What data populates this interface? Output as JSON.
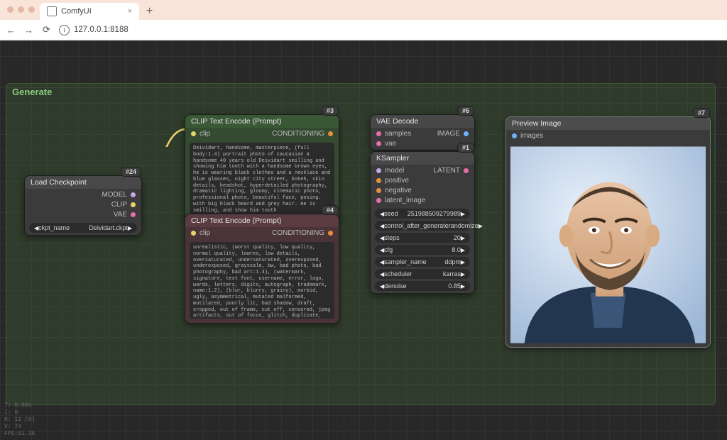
{
  "browser": {
    "tab_title": "ComfyUI",
    "new_tab": "+",
    "back": "←",
    "forward": "→",
    "reload": "⟳",
    "address": "127.0.0.1:8188"
  },
  "group": {
    "title": "Generate"
  },
  "nodes": {
    "load_ckpt": {
      "id": "#24",
      "title": "Load Checkpoint",
      "outputs": [
        "MODEL",
        "CLIP",
        "VAE"
      ],
      "widget_label": "ckpt_name",
      "widget_value": "Deividart.ckpt"
    },
    "clip_pos": {
      "id": "#3",
      "title": "CLIP Text Encode (Prompt)",
      "input": "clip",
      "output": "CONDITIONING",
      "text": "Deividart, handsome, masterpiece, (full body:1.4) portrait photo of caucasian a handsome 40 years old Deividart smilling and showing him tooth with a handsome brown eyes, he is wearing black clothes and a necklace and blue glasses, night city street, bokeh, skin details, headshot, hyperdetailed photography, dramatic lighting, gloomy, cinematic photo, professional photo, beautiful face, posing. with big black beard and grey hair. He is smilling, and show him tooth"
    },
    "clip_neg": {
      "id": "#4",
      "title": "CLIP Text Encode (Prompt)",
      "input": "clip",
      "output": "CONDITIONING",
      "text": "unrealistic, (worst quality, low quality, normal quality, lowres, low details, oversaturated, undersaturated, overexposed, underexposed, grayscale, bw, bad photo, bad photography, bad art:1.4), (watermark, signature, text font, username, error, logo, words, letters, digits, autograph, trademark, name:1.2), (blur, blurry, grainy), morbid, ugly, asymmetrical, mutated malformed, mutilated, poorly lit, bad shadow, draft, cropped, out of frame, cut off, censored, jpeg artifacts, out of focus, glitch, duplicate, (airbrushed, cartoon, anime, semi-realistic, cgi, render, blender, digital art, manga, amateur:1.3), (3D ,3D Game, 3D Game Scene, 3D Character) (nsfw, naked, nude, deformed iris, deformed pupils, semi-realistic, cgi, 3d, render, sketch, cartoon, drawing, anime, mutated hands and fingers:1.4), (deformed, distorted, disfigured:1.3), poorly drawn, bad anatomy, wrong anatomy, extra limb, missing limb, floating limbs, disconnected limbs, mutation, mutated"
    },
    "vae_decode": {
      "id": "#6",
      "title": "VAE Decode",
      "inputs": [
        "samples",
        "vae"
      ],
      "output": "IMAGE"
    },
    "ksampler": {
      "id": "#1",
      "title": "KSampler",
      "inputs": [
        "model",
        "positive",
        "negative",
        "latent_image"
      ],
      "output": "LATENT",
      "widgets": [
        {
          "label": "seed",
          "value": "251988509279989"
        },
        {
          "label": "control_after_generate",
          "value": "randomize"
        },
        {
          "label": "steps",
          "value": "20"
        },
        {
          "label": "cfg",
          "value": "8.0"
        },
        {
          "label": "sampler_name",
          "value": "ddpm"
        },
        {
          "label": "scheduler",
          "value": "karras"
        },
        {
          "label": "denoise",
          "value": "0.85"
        }
      ]
    },
    "preview": {
      "id": "#7",
      "title": "Preview Image",
      "input": "images"
    }
  },
  "stats": {
    "l0": "T: 0.60s",
    "l1": "I: 0",
    "l2": "N: 11 [0]",
    "l3": "V: 74",
    "l4": "FPS:61.35"
  }
}
